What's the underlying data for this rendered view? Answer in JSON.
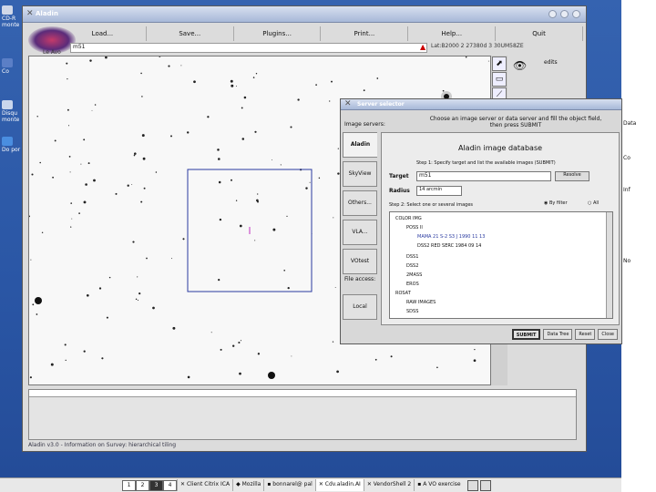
{
  "desktop": {
    "icons": [
      {
        "label": "CD-R monte",
        "color": "#d0d8e8"
      },
      {
        "label": "Co",
        "color": "#5b7fc6"
      },
      {
        "label": "Disqu monte",
        "color": "#c9d6ec"
      },
      {
        "label": "Do por",
        "color": "#4a8ee0"
      }
    ]
  },
  "aladin": {
    "title": "Aladin",
    "menu": [
      "Load...",
      "Save...",
      "Plugins...",
      "Print...",
      "Help...",
      "Quit"
    ],
    "logo_sub": "Le Avo",
    "command_value": "m51",
    "info_text": "Lat:B2000 2 27380d 3 30UM58ZE",
    "tools": [
      "⬈",
      "▭",
      "⟋",
      "▣",
      "✎",
      "◎"
    ],
    "edits_label": "edits",
    "status_text": "Aladin v3.0 - Information on Survey: hierarchical tiling",
    "accent": "#2a3aa0"
  },
  "server": {
    "title": "Server selector",
    "image_servers_label": "Image servers:",
    "intro": "Choose an image server or data server and fill the object field, then press SUBMIT",
    "tabs": [
      "Aladin",
      "SkyView",
      "Others...",
      "VLA...",
      "VOtest"
    ],
    "file_access_label": "File access:",
    "local_tab": "Local",
    "heading": "Aladin image database",
    "step": "Step 1: Specify target and list the available images (SUBMIT)",
    "target_label": "Target",
    "target_value": "m51",
    "resolve_label": "Resolve",
    "radius_label": "Radius",
    "radius_value": "14 arcmin",
    "tree_caption": "Step 2: Select one or several images",
    "option_a": "By filter",
    "option_b": "All",
    "tree": [
      "COLOR IMG",
      "POSS II",
      "MAMA 21 S-2 S3 J 1990 11 13",
      "DSS2 RED SERC 1984 09 14",
      "DSS1",
      "DSS2",
      "2MASS",
      "EROS",
      "ROSAT",
      "RAW IMAGES",
      "SDSS"
    ],
    "buttons": [
      "SUBMIT",
      "Data Tree",
      "Reset",
      "Close"
    ]
  },
  "right_edge": [
    "Data",
    "Co",
    "Inf",
    "No"
  ],
  "taskbar": {
    "pages": [
      "1",
      "2",
      "3",
      "4"
    ],
    "active_page": "3",
    "tasks": [
      "Client Citrix ICA",
      "Mozilla",
      "bonnarel@ pal",
      "Cdv.aladin.AI",
      "VendorShell 2",
      "A VO exercise"
    ]
  }
}
